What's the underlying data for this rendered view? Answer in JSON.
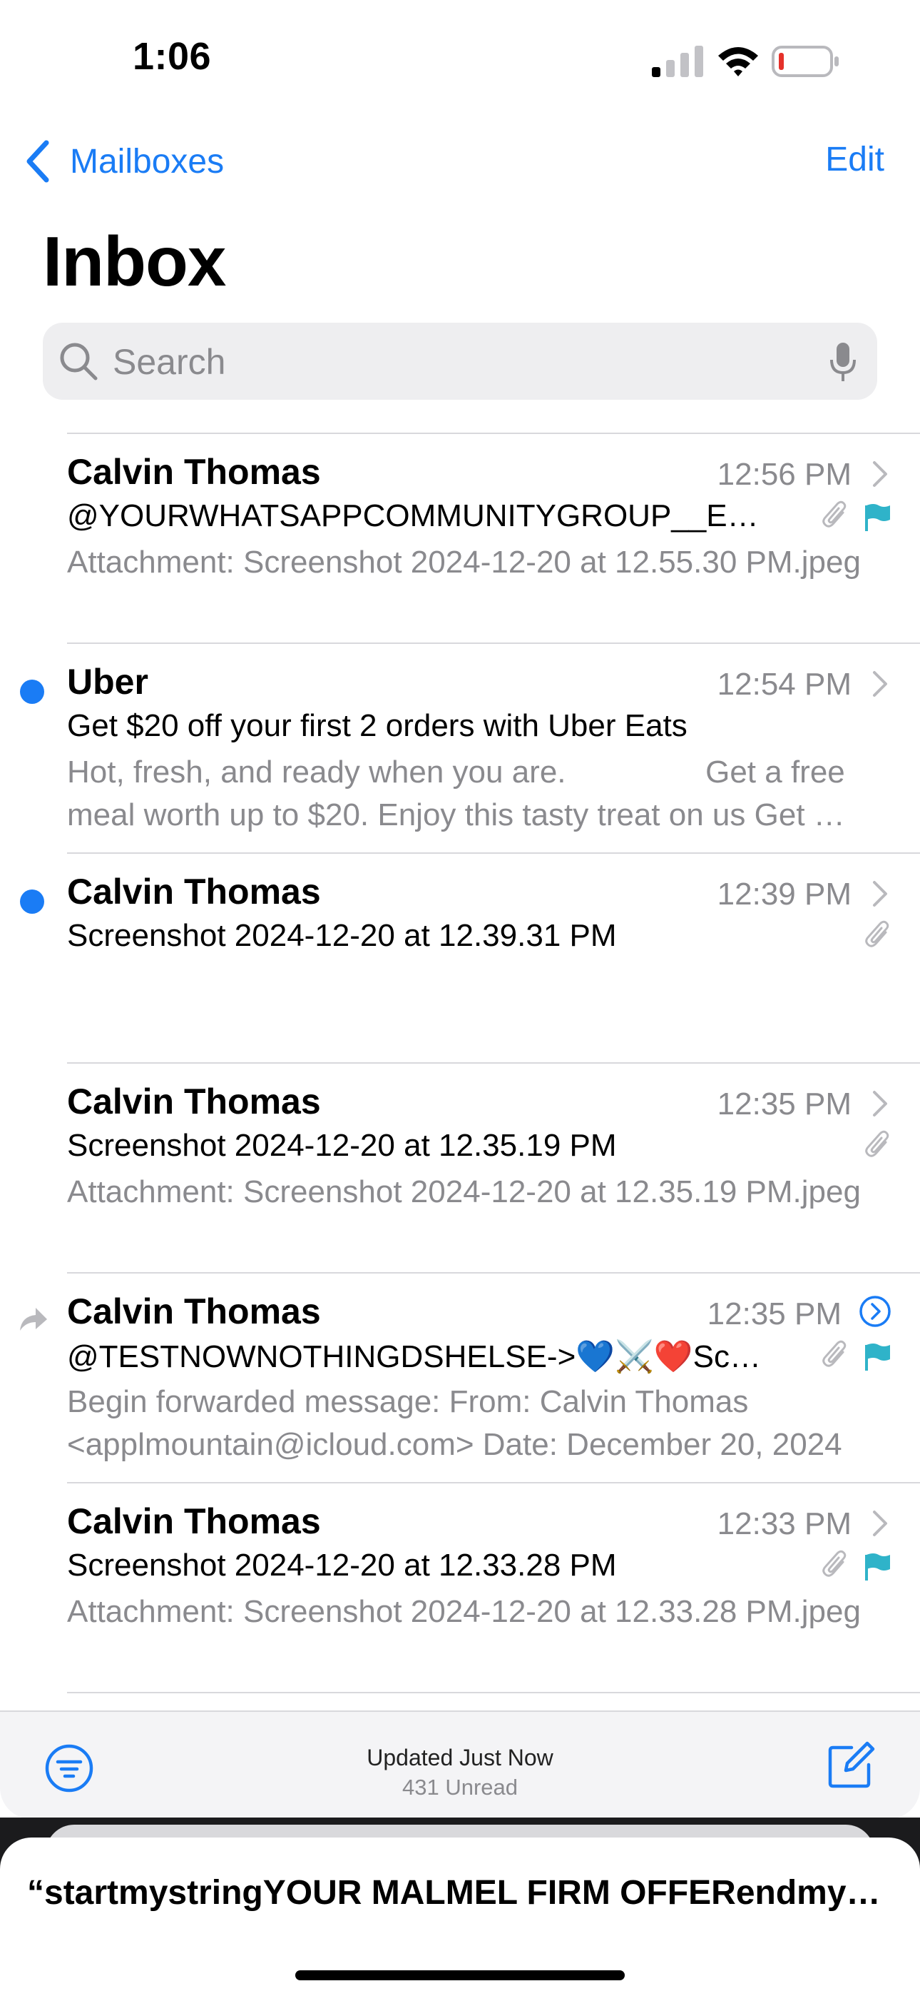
{
  "status_bar": {
    "time": "1:06",
    "icons": [
      "cellular-signal-icon",
      "wifi-icon",
      "battery-low-icon"
    ]
  },
  "nav": {
    "back_label": "Mailboxes",
    "edit_label": "Edit",
    "title": "Inbox"
  },
  "search": {
    "placeholder": "Search"
  },
  "messages": [
    {
      "sender": "Calvin Thomas",
      "time": "12:56 PM",
      "subject": "@YOURWHATSAPPCOMMUNITYGROUP__EMAIL",
      "preview": "Attachment: Screenshot 2024-12-20 at 12.55.30 PM.jpeg",
      "unread": false,
      "attachment": true,
      "flagged": true,
      "forwarded": false
    },
    {
      "sender": "Uber",
      "time": "12:54 PM",
      "subject": "Get $20 off your first 2 orders with Uber Eats",
      "preview": "Hot, fresh, and ready when you are.                Get a free meal worth up to $20. Enjoy this tasty treat on us Get started",
      "unread": true,
      "attachment": false,
      "flagged": false,
      "forwarded": false
    },
    {
      "sender": "Calvin Thomas",
      "time": "12:39 PM",
      "subject": "Screenshot 2024-12-20 at 12.39.31 PM",
      "preview": "",
      "unread": true,
      "attachment": true,
      "flagged": false,
      "forwarded": false
    },
    {
      "sender": "Calvin Thomas",
      "time": "12:35 PM",
      "subject": "Screenshot 2024-12-20 at 12.35.19 PM",
      "preview": "Attachment: Screenshot 2024-12-20 at 12.35.19 PM.jpeg",
      "unread": false,
      "attachment": true,
      "flagged": false,
      "forwarded": false
    },
    {
      "sender": "Calvin Thomas",
      "time": "12:35 PM",
      "subject": "@TESTNOWNOTHINGDSHELSE->💙⚔️❤️Screenshot",
      "preview": "Begin forwarded message: From: Calvin Thomas <applmountain@icloud.com> Date: December 20, 2024",
      "unread": false,
      "attachment": true,
      "flagged": true,
      "forwarded": true
    },
    {
      "sender": "Calvin Thomas",
      "time": "12:33 PM",
      "subject": "Screenshot 2024-12-20 at 12.33.28 PM",
      "preview": "Attachment: Screenshot 2024-12-20 at 12.33.28 PM.jpeg",
      "unread": false,
      "attachment": true,
      "flagged": true,
      "forwarded": false
    }
  ],
  "toolbar": {
    "status": "Updated Just Now",
    "unread_count": "431 Unread"
  },
  "sheet": {
    "title": "“startmystringYOUR MALMEL FIRM OFFERendmystring”"
  },
  "colors": {
    "accent": "#1a7cf5",
    "flag": "#2fb3c9",
    "secondary_text": "#8a8a8e",
    "separator": "#d8d8dc"
  }
}
